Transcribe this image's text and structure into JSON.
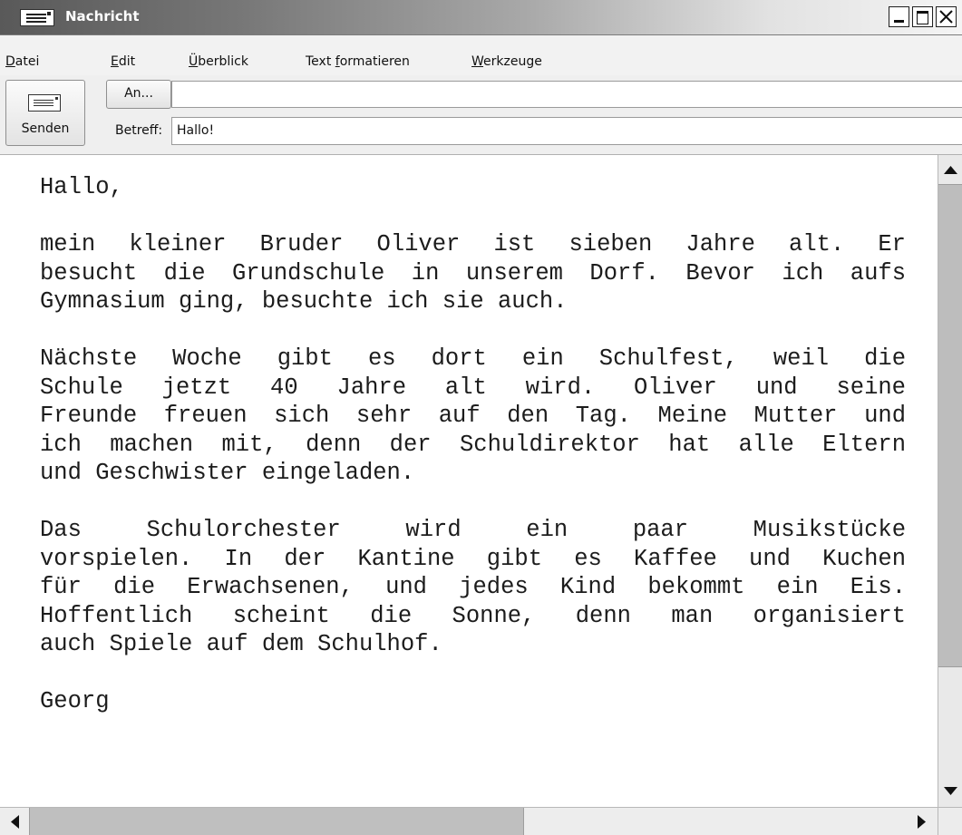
{
  "window": {
    "title": "Nachricht",
    "icon": "envelope-icon"
  },
  "menu": {
    "items": [
      {
        "mnemonic": "D",
        "rest": "atei"
      },
      {
        "mnemonic": "E",
        "rest": "dit"
      },
      {
        "mnemonic": "Ü",
        "rest": "berblick"
      },
      {
        "before": "Text ",
        "mnemonic": "f",
        "rest": "ormatieren"
      },
      {
        "mnemonic": "W",
        "rest": "erkzeuge"
      }
    ]
  },
  "compose": {
    "send_label": "Senden",
    "to_button_label": "An...",
    "to_value": "",
    "subject_label": "Betreff:",
    "subject_value": "Hallo!"
  },
  "message": {
    "lines": [
      {
        "text": "Hallo,",
        "paragraph_end": true
      },
      {
        "text": "",
        "gap": true
      },
      {
        "text": "mein kleiner Bruder Oliver ist sieben Jahre alt. Er"
      },
      {
        "text": "besucht die Grundschule in unserem Dorf. Bevor ich aufs"
      },
      {
        "text": "Gymnasium ging, besuchte ich sie auch.",
        "paragraph_end": true
      },
      {
        "text": "",
        "gap": true
      },
      {
        "text": "Nächste Woche gibt es dort ein Schulfest, weil die"
      },
      {
        "text": "Schule jetzt 40 Jahre alt wird. Oliver und seine"
      },
      {
        "text": "Freunde freuen sich sehr auf den Tag. Meine Mutter und"
      },
      {
        "text": "ich machen mit, denn der Schuldirektor hat alle Eltern"
      },
      {
        "text": "und Geschwister eingeladen.",
        "paragraph_end": true
      },
      {
        "text": "",
        "gap": true
      },
      {
        "text": "Das Schulorchester wird ein paar Musikstücke"
      },
      {
        "text": "vorspielen. In der Kantine gibt es Kaffee und Kuchen"
      },
      {
        "text": "für die Erwachsenen, und jedes Kind bekommt ein Eis."
      },
      {
        "text": "Hoffentlich scheint die Sonne, denn man organisiert"
      },
      {
        "text": "auch Spiele auf dem Schulhof.",
        "paragraph_end": true
      },
      {
        "text": "",
        "gap": true
      },
      {
        "text": "Georg",
        "paragraph_end": true
      }
    ]
  },
  "scrollbars": {
    "vertical_position": 0.0,
    "horizontal_position": 0.0
  }
}
